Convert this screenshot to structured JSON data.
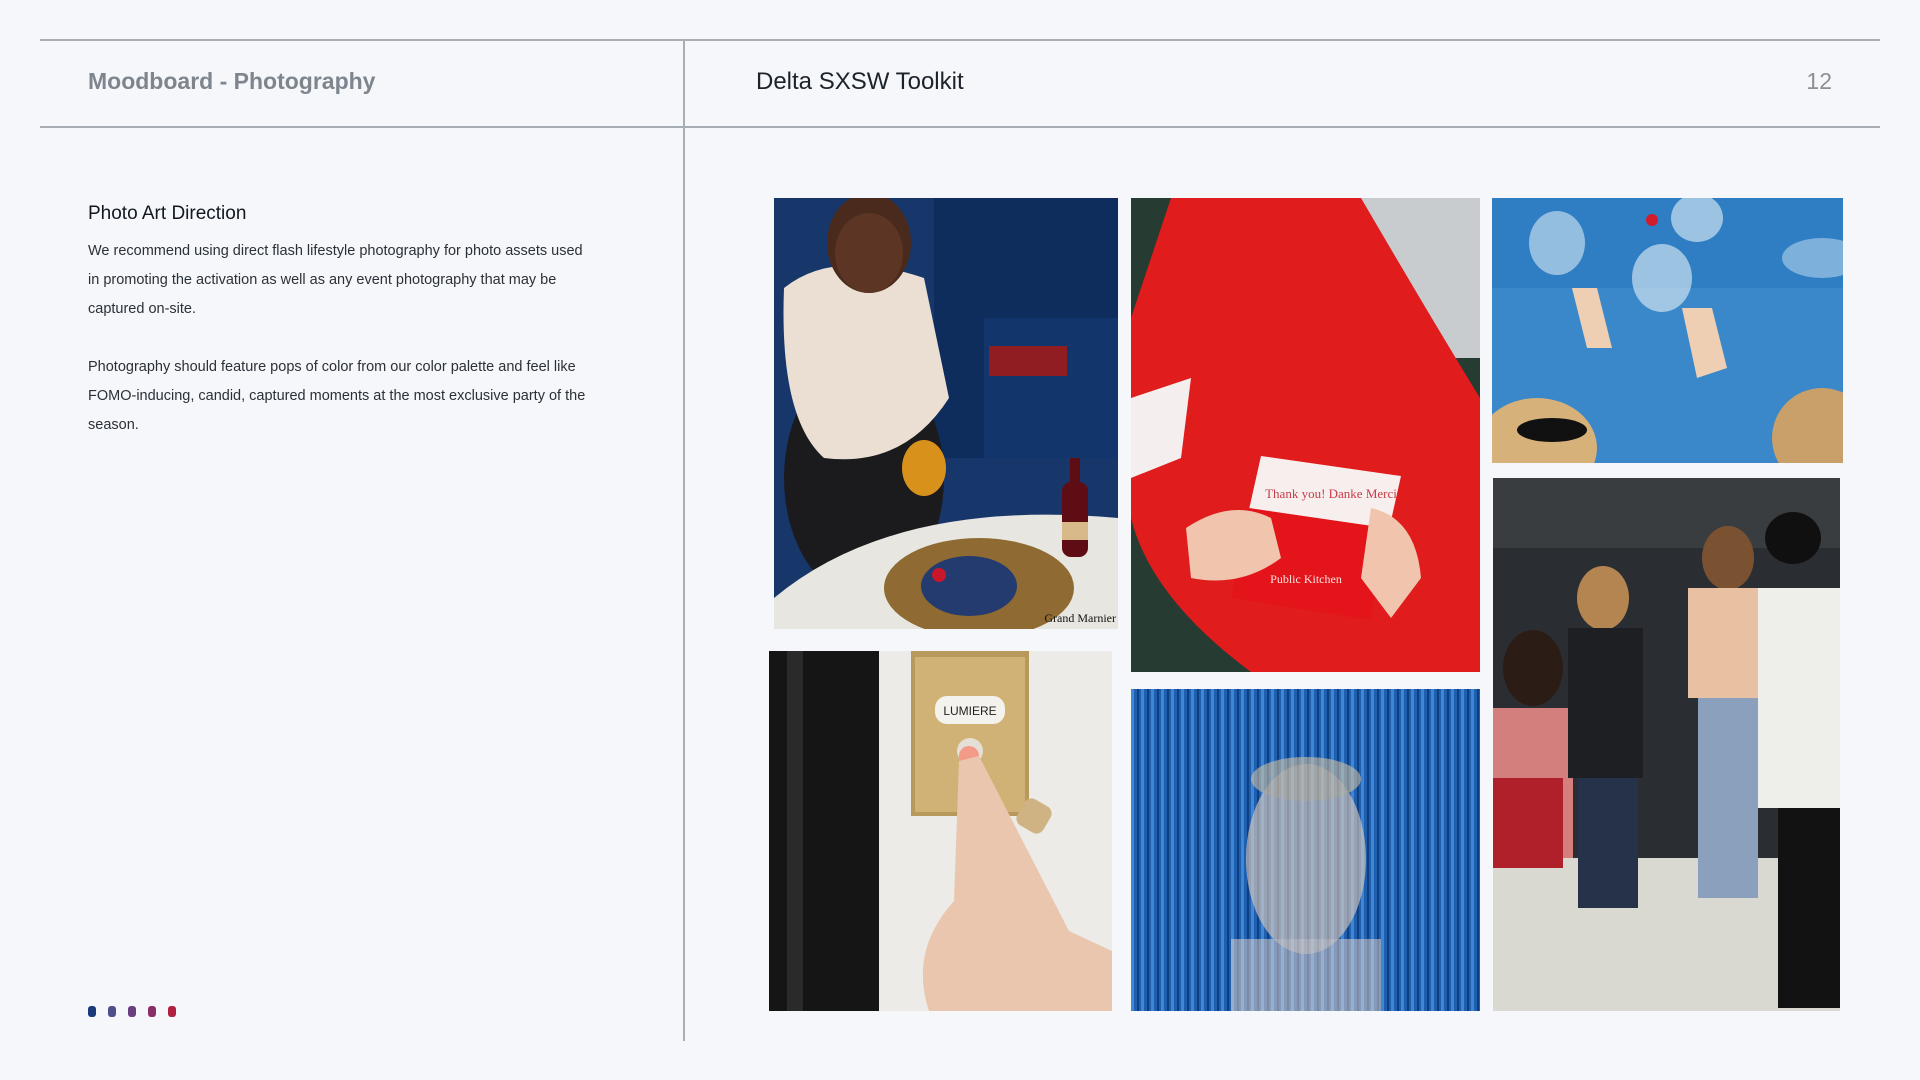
{
  "header": {
    "section_title": "Moodboard - Photography",
    "doc_title": "Delta SXSW Toolkit",
    "page_number": "12"
  },
  "content": {
    "heading": "Photo Art Direction",
    "paragraph_1": "We recommend using direct flash lifestyle photography for photo assets used in promoting the activation as well as any event photography that may be captured on-site.",
    "paragraph_2": "Photography should feature pops of color from our color palette and feel like FOMO-inducing, candid, captured moments at the most exclusive party of the season."
  },
  "palette": [
    "#1b3a7a",
    "#4f4f8c",
    "#6a3e80",
    "#8a2e68",
    "#b0223f"
  ],
  "photos": {
    "bottle_label": "Grand Marnier",
    "card_text": "Thank you! Danke Merci",
    "envelope_text": "Public Kitchen",
    "doorbell_label": "LUMIERE"
  }
}
